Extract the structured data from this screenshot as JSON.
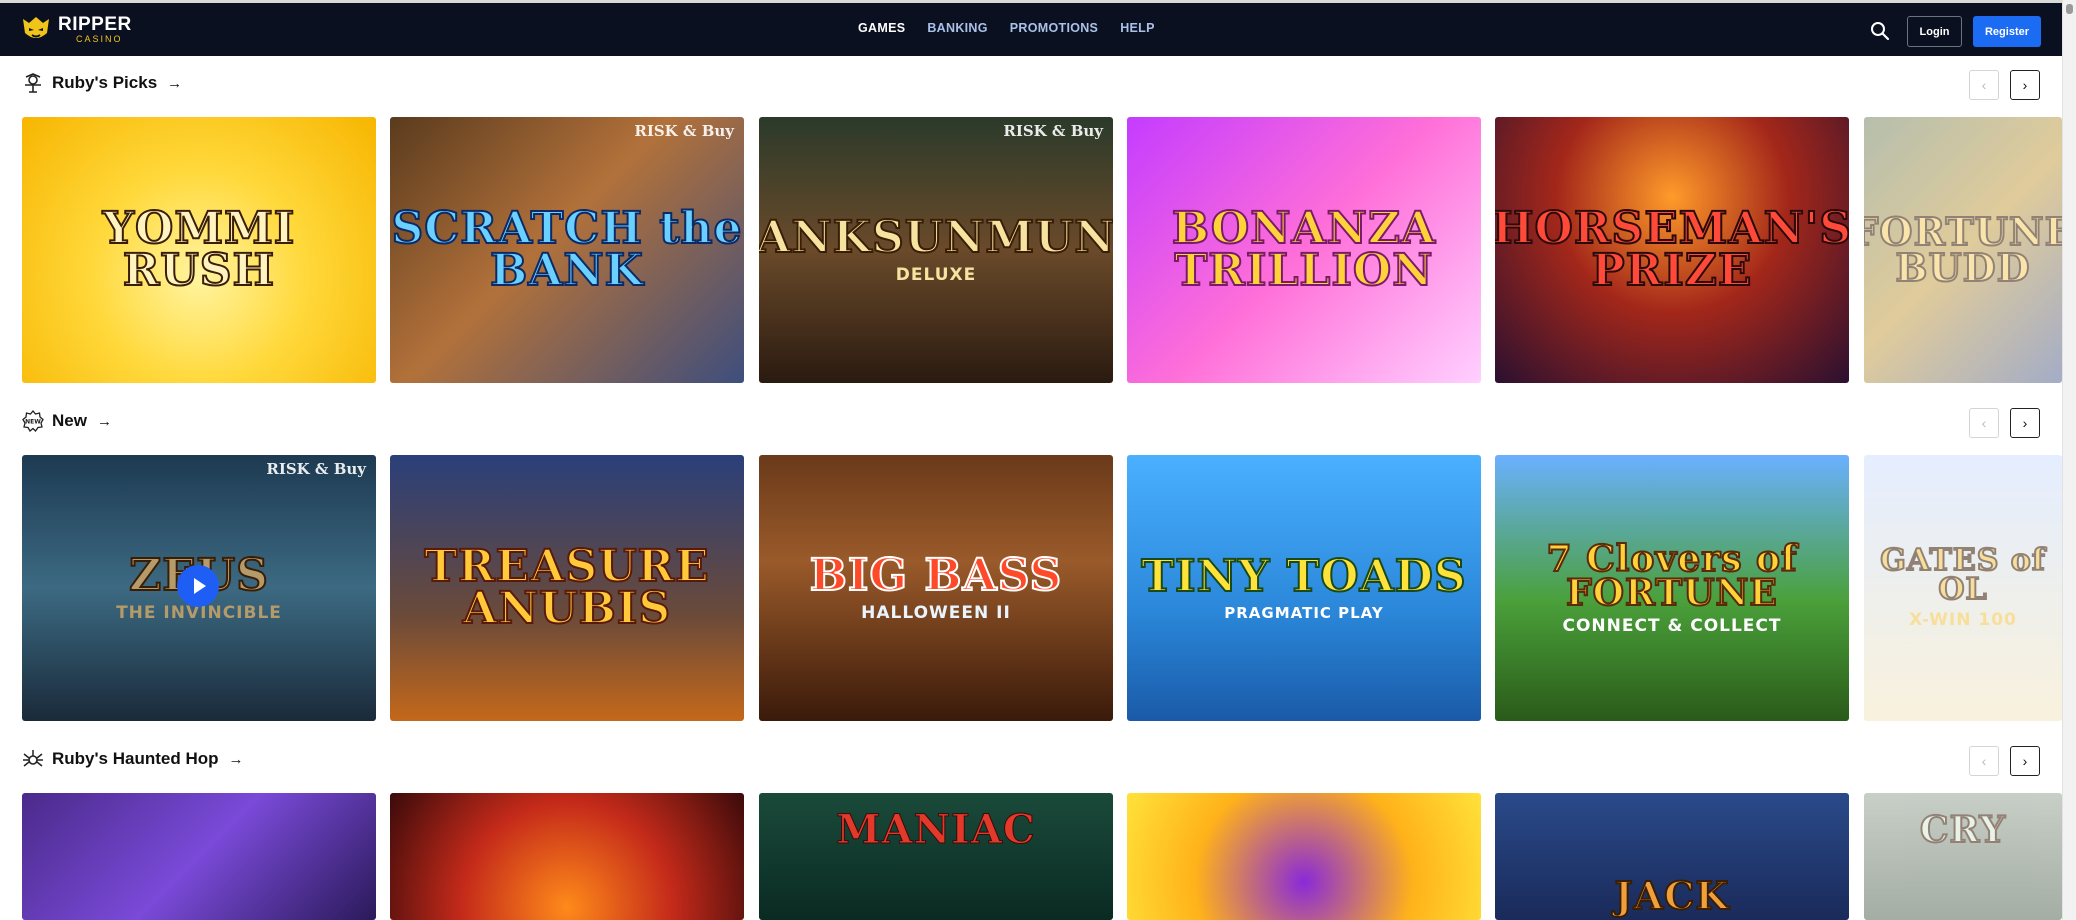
{
  "brand": {
    "name": "RIPPER",
    "tagline": "CASINO"
  },
  "nav": [
    {
      "label": "GAMES",
      "active": true
    },
    {
      "label": "BANKING",
      "active": false
    },
    {
      "label": "PROMOTIONS",
      "active": false
    },
    {
      "label": "HELP",
      "active": false
    }
  ],
  "header": {
    "login_label": "Login",
    "register_label": "Register",
    "search_icon": "search-icon"
  },
  "colors": {
    "topbar": "#0b1020",
    "register": "#1b6cf2",
    "nav_active": "#ffffff",
    "nav_inactive": "#a9c1e8"
  },
  "sections": [
    {
      "title": "Ruby's Picks",
      "icon": "scarecrow-icon",
      "games": [
        {
          "title": "YOMMI RUSH",
          "subtitle": "",
          "badge": ""
        },
        {
          "title": "SCRATCH the BANK",
          "subtitle": "",
          "badge": "RISK & Buy"
        },
        {
          "title": "ANKSUNMUN",
          "subtitle": "DELUXE",
          "badge": "RISK & Buy"
        },
        {
          "title": "BONANZA TRILLION",
          "subtitle": "",
          "badge": ""
        },
        {
          "title": "HORSEMAN'S PRIZE",
          "subtitle": "",
          "badge": ""
        },
        {
          "title": "FORTUNE BUDD",
          "subtitle": "",
          "badge": ""
        }
      ]
    },
    {
      "title": "New",
      "icon": "new-badge-icon",
      "games": [
        {
          "title": "ZEUS",
          "subtitle": "THE INVINCIBLE",
          "badge": "RISK & Buy"
        },
        {
          "title": "TREASURE ANUBIS",
          "subtitle": "",
          "badge": ""
        },
        {
          "title": "BIG BASS",
          "subtitle": "HALLOWEEN II",
          "badge": ""
        },
        {
          "title": "TINY TOADS",
          "subtitle": "PRAGMATIC PLAY",
          "badge": ""
        },
        {
          "title": "7 Clovers of FORTUNE",
          "subtitle": "CONNECT & COLLECT",
          "badge": ""
        },
        {
          "title": "GATES of OL",
          "subtitle": "X-WIN 100",
          "badge": ""
        }
      ]
    },
    {
      "title": "Ruby's Haunted Hop",
      "icon": "spider-icon",
      "games": [
        {
          "title": "",
          "subtitle": "",
          "badge": ""
        },
        {
          "title": "",
          "subtitle": "",
          "badge": ""
        },
        {
          "title": "MANIAC",
          "subtitle": "",
          "badge": ""
        },
        {
          "title": "",
          "subtitle": "",
          "badge": ""
        },
        {
          "title": "JACK",
          "subtitle": "",
          "badge": ""
        },
        {
          "title": "CRY",
          "subtitle": "",
          "badge": ""
        }
      ]
    }
  ]
}
